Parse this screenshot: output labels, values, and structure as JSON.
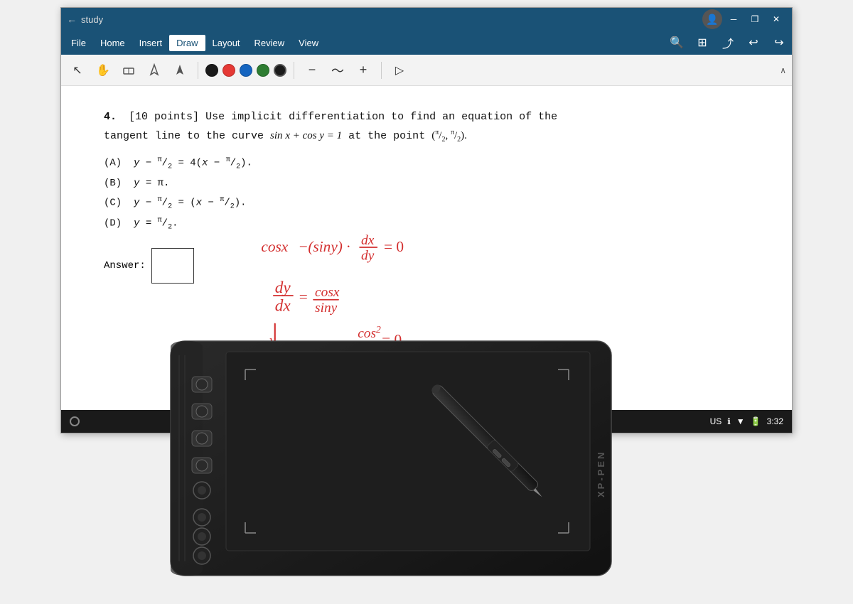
{
  "window": {
    "title": "study",
    "back_arrow": "←",
    "controls": {
      "minimize": "─",
      "restore": "❒",
      "close": "✕"
    }
  },
  "menu": {
    "items": [
      "File",
      "Home",
      "Insert",
      "Draw",
      "Layout",
      "Review",
      "View"
    ],
    "active": "Draw"
  },
  "toolbar": {
    "tools": [
      {
        "name": "select",
        "icon": "↖"
      },
      {
        "name": "lasso",
        "icon": "✋"
      },
      {
        "name": "eraser",
        "icon": "◻"
      },
      {
        "name": "pen1",
        "icon": "▽"
      },
      {
        "name": "pen2",
        "icon": "▼"
      }
    ],
    "colors": [
      "#1a1a1a",
      "#e53935",
      "#1565c0",
      "#2e7d32",
      "#212121"
    ],
    "separator": true,
    "actions": [
      {
        "name": "minus",
        "icon": "─"
      },
      {
        "name": "wave",
        "icon": "〜"
      },
      {
        "name": "plus",
        "icon": "+"
      }
    ],
    "draw_icon": "▷"
  },
  "document": {
    "question_number": "4.",
    "points": "[10 points]",
    "question_line1": "Use implicit differentiation to find an equation of the",
    "question_line2": "tangent line to the curve",
    "equation": "sin x + cos y = 1",
    "at_point": "at the point",
    "point_coords": "(π/2, π/2).",
    "choices": [
      {
        "label": "(A)",
        "expr": "y − π/2 = 4(x − π/2)."
      },
      {
        "label": "(B)",
        "expr": "y = π."
      },
      {
        "label": "(C)",
        "expr": "y − π/2 = (x − π/2)."
      },
      {
        "label": "(D)",
        "expr": "y = π/2."
      }
    ],
    "answer_label": "Answer:"
  },
  "handwriting": {
    "lines": [
      "cosx − (siny) · dx/dy = 0",
      "dy/dx = cosx/siny",
      "|y| = cosx²/(siny) = 0"
    ]
  },
  "status_bar": {
    "locale": "US",
    "time": "3:32",
    "battery_icon": "🔋"
  },
  "tablet": {
    "brand": "XP-PEN",
    "color": "#1a1a1a"
  }
}
